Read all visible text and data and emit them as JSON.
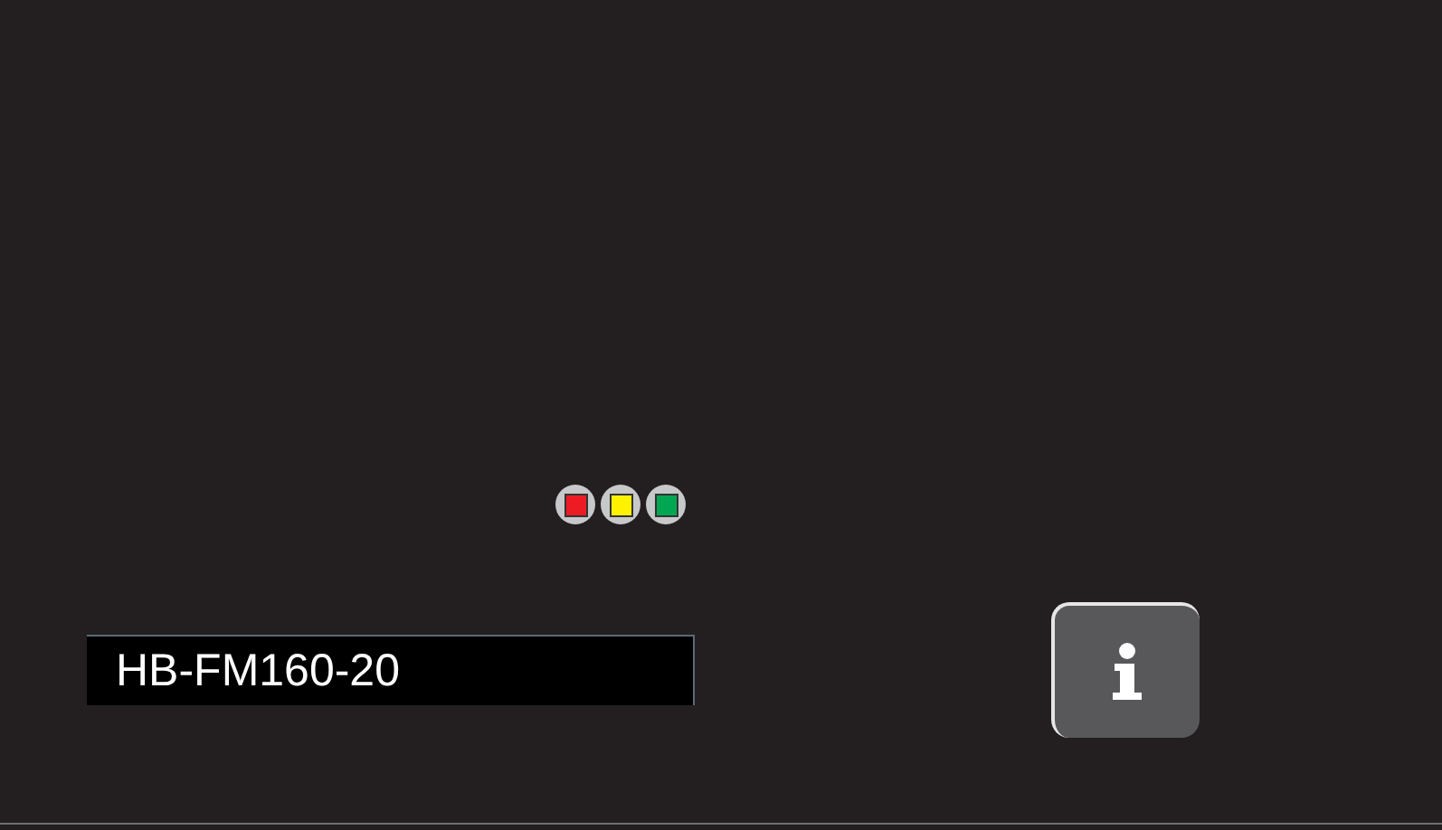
{
  "indicators": [
    {
      "color": "#ed1c24"
    },
    {
      "color": "#fff200"
    },
    {
      "color": "#00a651"
    }
  ],
  "device_field": {
    "value": "HB-FM160-20"
  }
}
